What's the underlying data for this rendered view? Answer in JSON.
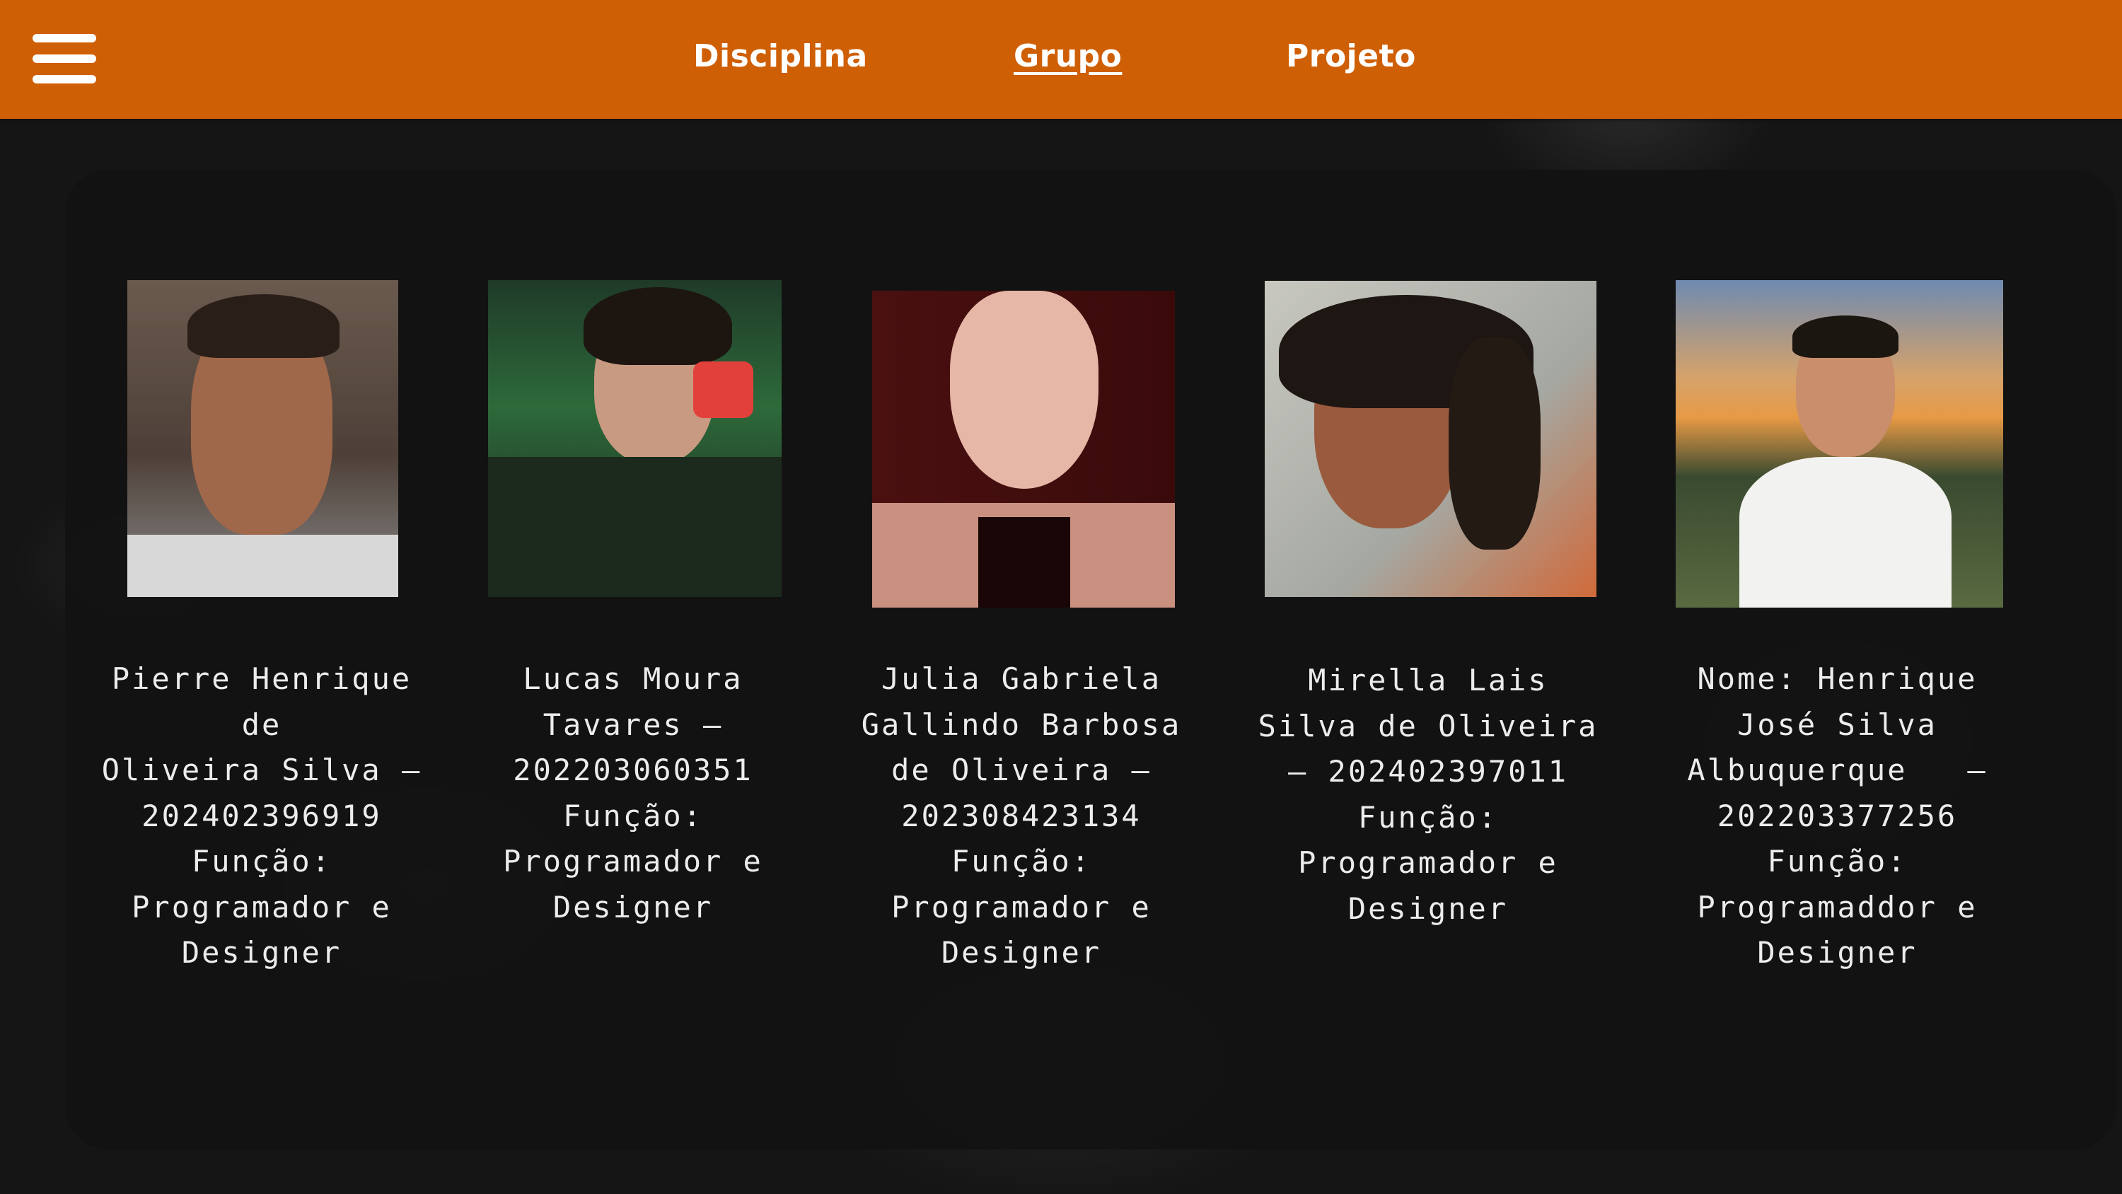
{
  "header": {
    "menu_icon": "hamburger-menu-icon",
    "nav": [
      {
        "label": "Disciplina",
        "active": false
      },
      {
        "label": "Grupo",
        "active": true
      },
      {
        "label": "Projeto",
        "active": false
      }
    ],
    "background_color": "#cf5f05"
  },
  "members": [
    {
      "lines": [
        "Pierre Henrique de",
        "Oliveira Silva –",
        "202402396919",
        "Função:",
        "Programador e",
        "Designer"
      ]
    },
    {
      "lines": [
        "Lucas Moura",
        "Tavares –",
        "202203060351",
        "Função:",
        "Programador e",
        "Designer"
      ]
    },
    {
      "lines": [
        "Julia Gabriela",
        "Gallindo Barbosa",
        "de Oliveira –",
        "202308423134",
        "Função:",
        "Programador e",
        "Designer"
      ]
    },
    {
      "lines": [
        "Mirella Lais",
        "Silva de Oliveira",
        "– 202402397011",
        "Função:",
        "Programador e",
        "Designer"
      ]
    },
    {
      "lines": [
        "Nome: Henrique",
        "José Silva",
        "Albuquerque   –",
        "202203377256",
        "Função:",
        "Programaddor e",
        "Designer"
      ]
    }
  ]
}
